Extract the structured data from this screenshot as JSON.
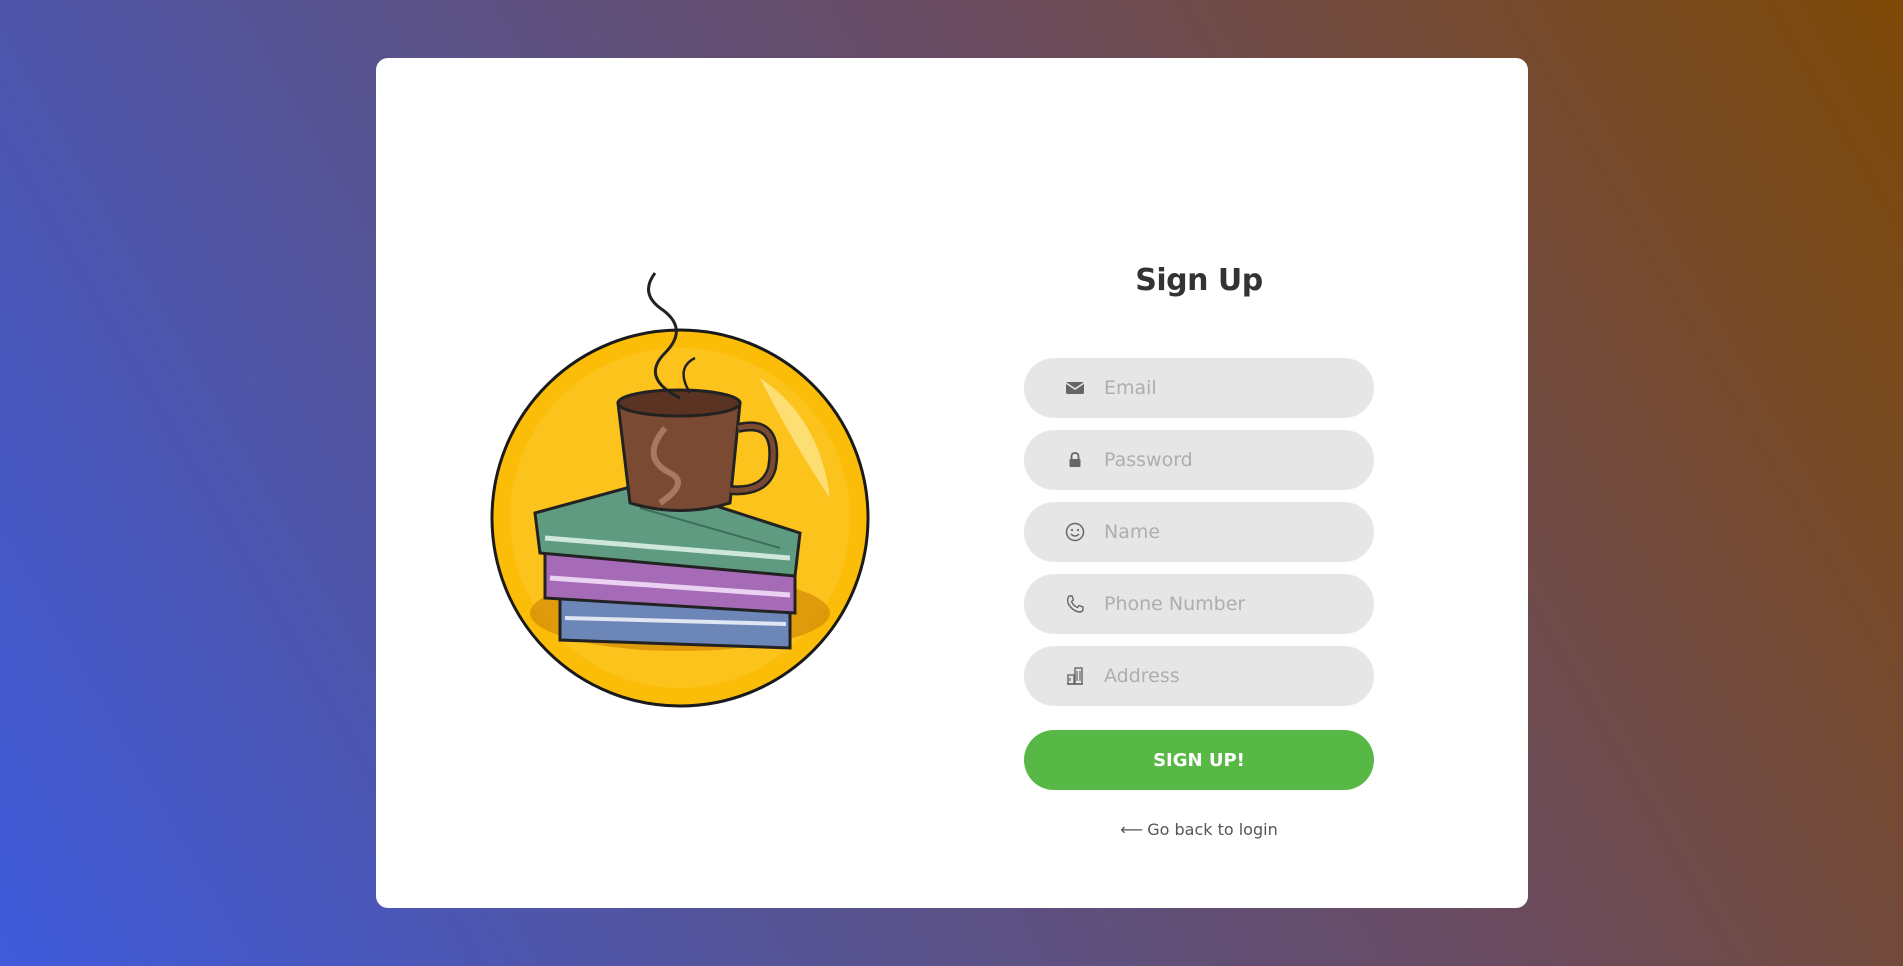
{
  "form": {
    "title": "Sign Up",
    "fields": [
      {
        "icon": "envelope-icon",
        "placeholder": "Email",
        "value": ""
      },
      {
        "icon": "lock-icon",
        "placeholder": "Password",
        "value": ""
      },
      {
        "icon": "smiley-icon",
        "placeholder": "Name",
        "value": ""
      },
      {
        "icon": "phone-icon",
        "placeholder": "Phone Number",
        "value": ""
      },
      {
        "icon": "building-icon",
        "placeholder": "Address",
        "value": ""
      }
    ],
    "submit_label": "SIGN UP!",
    "back_link_label": "Go back to login",
    "back_link_arrow": "⟵"
  },
  "colors": {
    "button": "#57b846",
    "field_bg": "#e6e6e6",
    "illustration_circle": "#fbbd08"
  }
}
